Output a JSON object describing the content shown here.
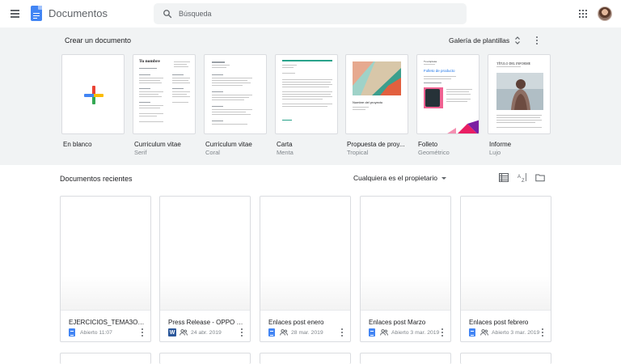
{
  "header": {
    "app_title": "Documentos",
    "search_placeholder": "Búsqueda",
    "menu_icon": "hamburger-menu-icon",
    "apps_icon": "apps-grid-icon"
  },
  "templates": {
    "section_title": "Crear un documento",
    "gallery_label": "Galería de plantillas",
    "items": [
      {
        "name": "En blanco",
        "sub": ""
      },
      {
        "name": "Curriculum vitae",
        "sub": "Serif"
      },
      {
        "name": "Curriculum vitae",
        "sub": "Coral"
      },
      {
        "name": "Carta",
        "sub": "Menta"
      },
      {
        "name": "Propuesta de proy...",
        "sub": "Tropical"
      },
      {
        "name": "Folleto",
        "sub": "Geométrico"
      },
      {
        "name": "Informe",
        "sub": "Lujo"
      }
    ],
    "thumb_text": {
      "serif_heading": "Tu nombre",
      "project_name": "Nombre del proyecto",
      "brochure_brand": "Tu empresa",
      "brochure_heading": "Folleto de producto",
      "report_title": "TÍTULO DEL INFORME"
    }
  },
  "recent": {
    "title": "Documentos recientes",
    "owner_filter": "Cualquiera es el propietario",
    "docs": [
      {
        "name": "EJERCICIOS_TEMA3Obje...",
        "meta": "Abierto 11:07",
        "type": "gdoc",
        "shared": false
      },
      {
        "name": "Press Release - OPPO Re...",
        "meta": "24 abr. 2019",
        "type": "word",
        "shared": true
      },
      {
        "name": "Enlaces post enero",
        "meta": "28 mar. 2019",
        "type": "gdoc",
        "shared": true
      },
      {
        "name": "Enlaces post Marzo",
        "meta": "Abierto 3 mar. 2019",
        "type": "gdoc",
        "shared": true
      },
      {
        "name": "Enlaces post febrero",
        "meta": "Abierto 3 mar. 2019",
        "type": "gdoc",
        "shared": true
      }
    ],
    "word_badge": "W"
  },
  "colors": {
    "docs_blue": "#4285f4",
    "word_blue": "#2b579a",
    "template_bg": "#f1f3f4",
    "menta_accent": "#29a38b"
  }
}
